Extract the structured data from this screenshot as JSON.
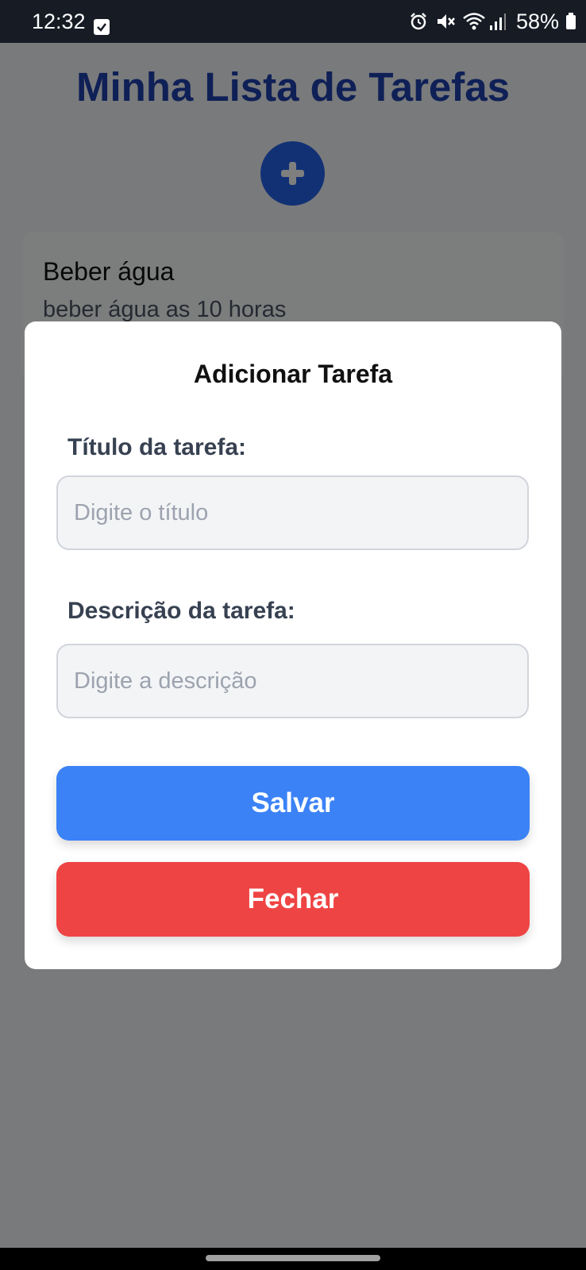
{
  "status_bar": {
    "time": "12:32",
    "battery": "58%",
    "icons": [
      "checkbox-notification-icon",
      "alarm-icon",
      "mute-icon",
      "wifi-icon",
      "signal-icon",
      "battery-icon"
    ]
  },
  "app": {
    "title": "Minha Lista de Tarefas",
    "add_button_icon": "plus-icon",
    "tasks": [
      {
        "title": "Beber água",
        "description": "beber água as 10 horas"
      }
    ]
  },
  "modal": {
    "title": "Adicionar Tarefa",
    "title_field_label": "Título da tarefa:",
    "title_field_placeholder": "Digite o título",
    "description_field_label": "Descrição da tarefa:",
    "description_field_placeholder": "Digite a descrição",
    "save_label": "Salvar",
    "close_label": "Fechar"
  },
  "colors": {
    "title_blue": "#1e40af",
    "save_blue": "#3b82f6",
    "close_red": "#ef4444",
    "overlay": "rgba(0,0,0,0.5)"
  }
}
